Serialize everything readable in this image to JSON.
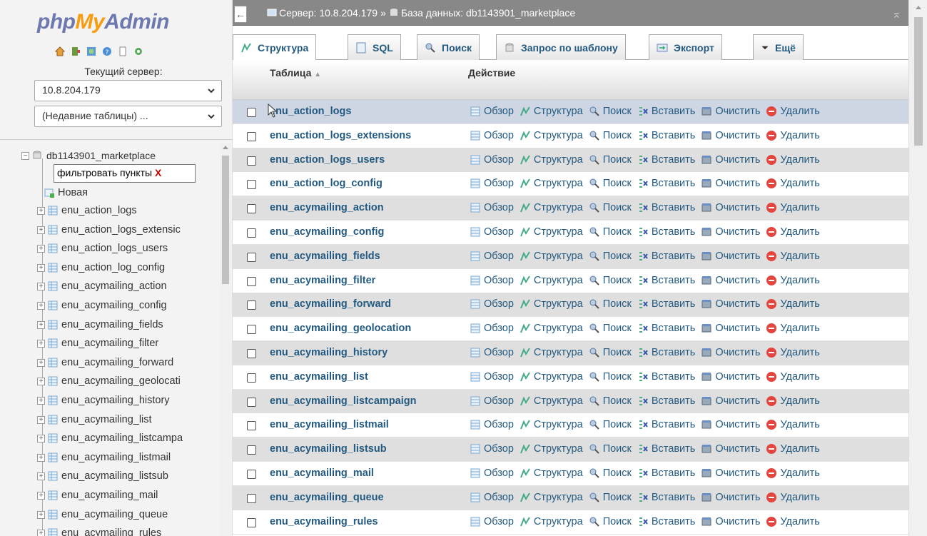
{
  "logo": {
    "php": "php",
    "my": "My",
    "admin": "Admin"
  },
  "server_label": "Текущий сервер:",
  "server_select": "10.8.204.179",
  "recent_select": "(Недавние таблицы) ...",
  "tree": {
    "db_name": "db1143901_marketplace",
    "filter_text": "фильтровать пункты",
    "filter_clear": "X",
    "new_label": "Новая",
    "items": [
      "enu_action_logs",
      "enu_action_logs_extensic",
      "enu_action_logs_users",
      "enu_action_log_config",
      "enu_acymailing_action",
      "enu_acymailing_config",
      "enu_acymailing_fields",
      "enu_acymailing_filter",
      "enu_acymailing_forward",
      "enu_acymailing_geolocati",
      "enu_acymailing_history",
      "enu_acymailing_list",
      "enu_acymailing_listcampa",
      "enu_acymailing_listmail",
      "enu_acymailing_listsub",
      "enu_acymailing_mail",
      "enu_acymailing_queue",
      "enu_acymailing_rules"
    ]
  },
  "breadcrumb": {
    "server": "Сервер: 10.8.204.179",
    "sep": "»",
    "database": "База данных: db1143901_marketplace"
  },
  "tabs": [
    "Структура",
    "SQL",
    "Поиск",
    "Запрос по шаблону",
    "Экспорт",
    "Ещё"
  ],
  "table_header": {
    "table": "Таблица",
    "sort_mark": "▲",
    "action": "Действие"
  },
  "actions": [
    "Обзор",
    "Структура",
    "Поиск",
    "Вставить",
    "Очистить",
    "Удалить"
  ],
  "tables": [
    "enu_action_logs",
    "enu_action_logs_extensions",
    "enu_action_logs_users",
    "enu_action_log_config",
    "enu_acymailing_action",
    "enu_acymailing_config",
    "enu_acymailing_fields",
    "enu_acymailing_filter",
    "enu_acymailing_forward",
    "enu_acymailing_geolocation",
    "enu_acymailing_history",
    "enu_acymailing_list",
    "enu_acymailing_listcampaign",
    "enu_acymailing_listmail",
    "enu_acymailing_listsub",
    "enu_acymailing_mail",
    "enu_acymailing_queue",
    "enu_acymailing_rules"
  ],
  "colors": {
    "link": "#235a81",
    "logo_blue": "#6c78af",
    "logo_orange": "#f89c0e",
    "row_highlight": "#ced6e4"
  }
}
